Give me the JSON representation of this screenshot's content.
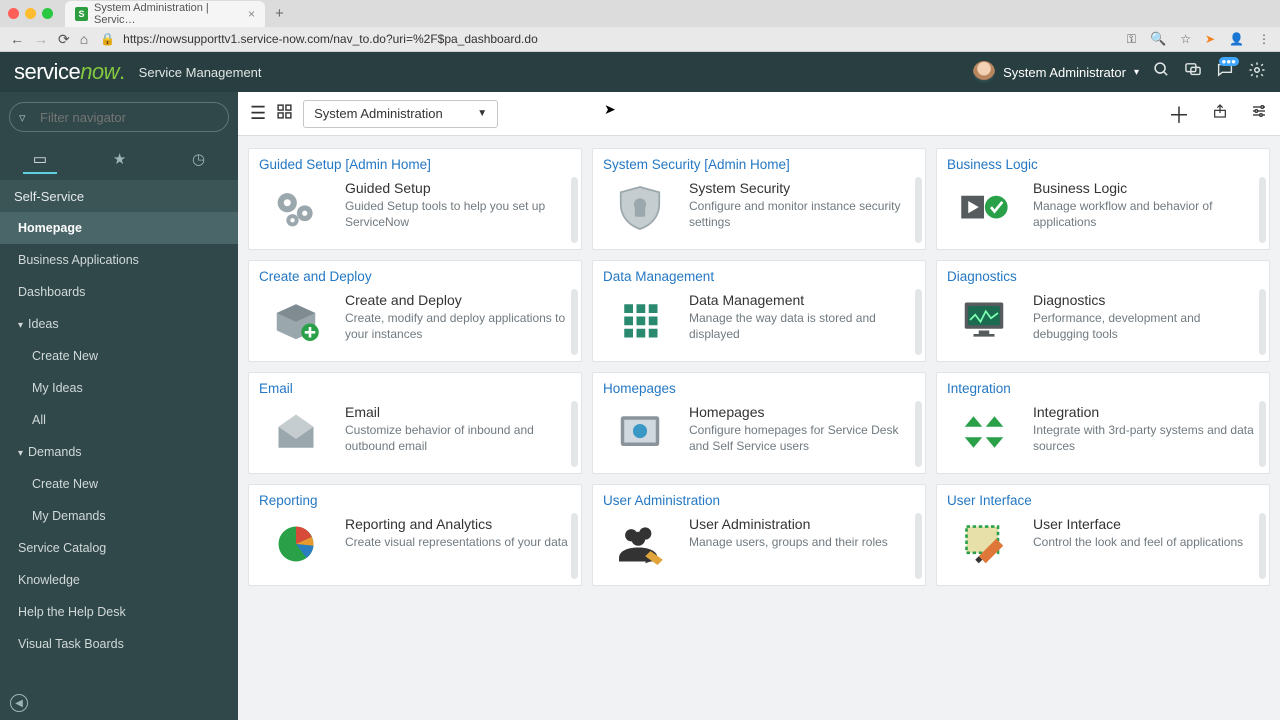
{
  "browser": {
    "tab_title": "System Administration | Servic…",
    "url": "https://nowsupporttv1.service-now.com/nav_to.do?uri=%2F$pa_dashboard.do"
  },
  "header": {
    "logo_left": "service",
    "logo_right": "now",
    "subtitle": "Service Management",
    "user_name": "System Administrator"
  },
  "sidebar": {
    "filter_placeholder": "Filter navigator",
    "section": "Self-Service",
    "items": [
      {
        "label": "Homepage",
        "type": "item",
        "active": true
      },
      {
        "label": "Business Applications",
        "type": "item"
      },
      {
        "label": "Dashboards",
        "type": "item"
      },
      {
        "label": "Ideas",
        "type": "toggle"
      },
      {
        "label": "Create New",
        "type": "sub"
      },
      {
        "label": "My Ideas",
        "type": "sub"
      },
      {
        "label": "All",
        "type": "sub"
      },
      {
        "label": "Demands",
        "type": "toggle"
      },
      {
        "label": "Create New",
        "type": "sub"
      },
      {
        "label": "My Demands",
        "type": "sub"
      },
      {
        "label": "Service Catalog",
        "type": "item"
      },
      {
        "label": "Knowledge",
        "type": "item"
      },
      {
        "label": "Help the Help Desk",
        "type": "item"
      },
      {
        "label": "Visual Task Boards",
        "type": "item"
      }
    ]
  },
  "toolbar": {
    "page_select": "System Administration"
  },
  "cards": [
    {
      "header": "Guided Setup [Admin Home]",
      "title": "Guided Setup",
      "desc": "Guided Setup tools to help you set up ServiceNow",
      "icon": "gears"
    },
    {
      "header": "System Security [Admin Home]",
      "title": "System Security",
      "desc": "Configure and monitor instance security settings",
      "icon": "shield"
    },
    {
      "header": "Business Logic",
      "title": "Business Logic",
      "desc": "Manage workflow and behavior of applications",
      "icon": "playcheck"
    },
    {
      "header": "Create and Deploy",
      "title": "Create and Deploy",
      "desc": "Create, modify and deploy applications to your instances",
      "icon": "box"
    },
    {
      "header": "Data Management",
      "title": "Data Management",
      "desc": "Manage the way data is stored and displayed",
      "icon": "grid"
    },
    {
      "header": "Diagnostics",
      "title": "Diagnostics",
      "desc": "Performance, development and debugging tools",
      "icon": "monitor"
    },
    {
      "header": "Email",
      "title": "Email",
      "desc": "Customize behavior of inbound and outbound email",
      "icon": "envelope"
    },
    {
      "header": "Homepages",
      "title": "Homepages",
      "desc": "Configure homepages for Service Desk and Self Service users",
      "icon": "image"
    },
    {
      "header": "Integration",
      "title": "Integration",
      "desc": "Integrate with 3rd-party systems and data sources",
      "icon": "arrows"
    },
    {
      "header": "Reporting",
      "title": "Reporting and Analytics",
      "desc": "Create visual representations of your data",
      "icon": "pie"
    },
    {
      "header": "User Administration",
      "title": "User Administration",
      "desc": "Manage users, groups and their roles",
      "icon": "users"
    },
    {
      "header": "User Interface",
      "title": "User Interface",
      "desc": "Control the look and feel of applications",
      "icon": "uipaint"
    }
  ]
}
